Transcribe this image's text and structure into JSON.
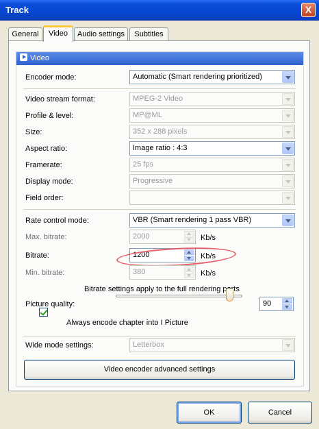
{
  "window": {
    "title": "Track",
    "close_glyph": "X"
  },
  "tabs": [
    {
      "label": "General",
      "active": false
    },
    {
      "label": "Video",
      "active": true
    },
    {
      "label": "Audio settings",
      "active": false
    },
    {
      "label": "Subtitles",
      "active": false
    }
  ],
  "group": {
    "title": "Video",
    "icon": "arrow-right-icon"
  },
  "fields": {
    "encoder_mode": {
      "label": "Encoder mode:",
      "value": "Automatic (Smart rendering prioritized)",
      "enabled": true
    },
    "video_stream_format": {
      "label": "Video stream format:",
      "value": "MPEG-2 Video",
      "enabled": false
    },
    "profile_level": {
      "label": "Profile & level:",
      "value": "MP@ML",
      "enabled": false
    },
    "size": {
      "label": "Size:",
      "value": "352 x 288 pixels",
      "enabled": false
    },
    "aspect_ratio": {
      "label": "Aspect ratio:",
      "value": "Image ratio : 4:3",
      "enabled": true
    },
    "framerate": {
      "label": "Framerate:",
      "value": "25  fps",
      "enabled": false
    },
    "display_mode": {
      "label": "Display mode:",
      "value": "Progressive",
      "enabled": false
    },
    "field_order": {
      "label": "Field order:",
      "value": "",
      "enabled": false
    },
    "rate_control_mode": {
      "label": "Rate control mode:",
      "value": "VBR (Smart rendering 1 pass VBR)",
      "enabled": true
    },
    "max_bitrate": {
      "label": "Max. bitrate:",
      "value": "2000",
      "unit": "Kb/s",
      "enabled": false
    },
    "bitrate": {
      "label": "Bitrate:",
      "value": "1200",
      "unit": "Kb/s",
      "enabled": true
    },
    "min_bitrate": {
      "label": "Min. bitrate:",
      "value": "380",
      "unit": "Kb/s",
      "enabled": false
    },
    "bitrate_note": "Bitrate settings apply to the full rendering parts",
    "picture_quality": {
      "label": "Picture quality:",
      "value": "90",
      "slider_fraction": 0.9
    },
    "chapter_checkbox": {
      "label": "Always encode chapter into I Picture",
      "checked": true
    },
    "wide_mode": {
      "label": "Wide mode settings:",
      "value": "Letterbox",
      "enabled": false
    }
  },
  "advanced_button": "Video encoder advanced settings",
  "buttons": {
    "ok": "OK",
    "cancel": "Cancel"
  },
  "colors": {
    "titlebar": "#0846d0",
    "annotation": "#e4606c",
    "active_tab": "#ffc83c"
  }
}
